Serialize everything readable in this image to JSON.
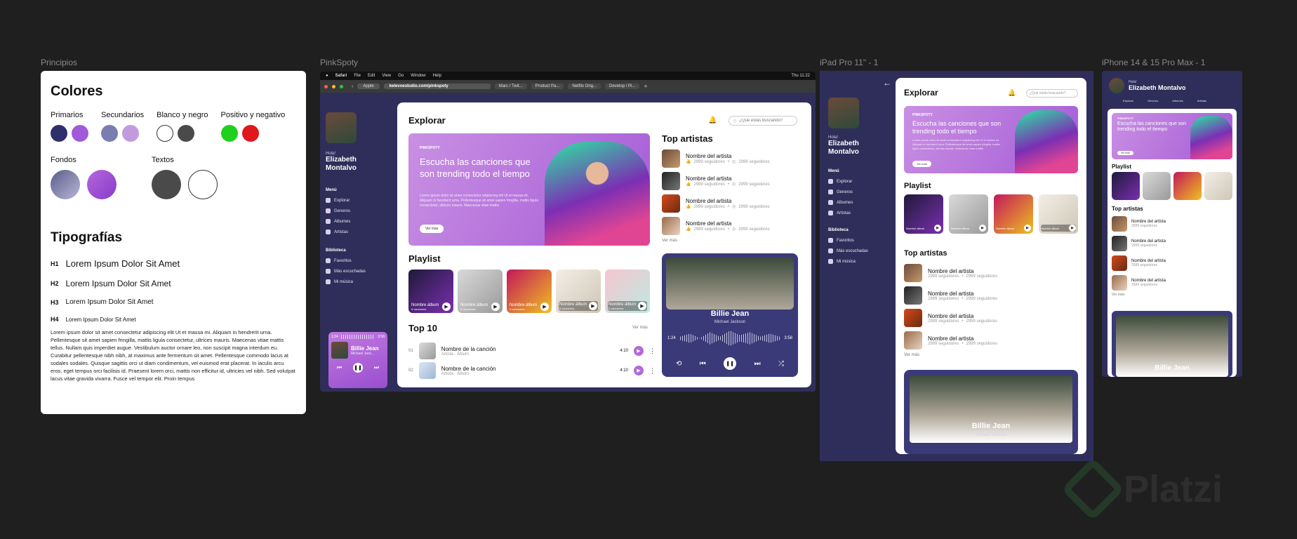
{
  "frames": {
    "principios": "Principios",
    "pinkspoty": "PinkSpoty",
    "ipad": "iPad Pro 11\" - 1",
    "iphone": "iPhone 14 & 15 Pro Max - 1"
  },
  "styleguide": {
    "colors_title": "Colores",
    "groups": [
      {
        "label": "Primarios",
        "swatches": [
          "#2e2f6b",
          "#a259d9"
        ]
      },
      {
        "label": "Secundarios",
        "swatches": [
          "#7a7db0",
          "#c29bdc"
        ]
      },
      {
        "label": "Blanco y negro",
        "swatches": [
          "#ffffff",
          "#4a4a4a"
        ]
      },
      {
        "label": "Positivo y negativo",
        "swatches": [
          "#1fd11f",
          "#e0171b"
        ]
      }
    ],
    "fondos_label": "Fondos",
    "textos_label": "Textos",
    "typo_title": "Tipografías",
    "headings": [
      {
        "tag": "H1",
        "text": "Lorem Ipsum Dolor Sit Amet"
      },
      {
        "tag": "H2",
        "text": "Lorem Ipsum Dolor Sit Amet"
      },
      {
        "tag": "H3",
        "text": "Lorem Ipsum Dolor Sit Amet"
      },
      {
        "tag": "H4",
        "text": "Lorem Ipsum Dolor Sit Amet"
      }
    ],
    "paragraph": "Lorem ipsum dolor sit amet consectetur adipiscing elit Ut et massa mi. Aliquam in hendrerit urna. Pellentesque sit amet sapien fringilla, mattis ligula consectetur, ultrices mauris. Maecenas vitae mattis tellus. Nullam quis imperdiet augue. Vestibulum auctor ornare leo, non suscipit magna interdum eu. Curabitur pellentesque nibh nibh, at maximus ante fermentum sit amet. Pellentesque commodo lacus at sodales sodales. Quisque sagittis orci ut diam condimentum, vel euismod erat placerat. In iaculis arcu eros, eget tempus orci facilisis id. Praesent lorem orci, mattis non efficitur id, ultricies vel nibh. Sed volutpat lacus vitae gravida vivarra. Fusce vel tempor elit. Proin tempus"
  },
  "browser": {
    "menu": [
      "Safari",
      "File",
      "Edit",
      "View",
      "Go",
      "Window",
      "Help"
    ],
    "clock": "Thu 11:22",
    "url": "kelevoestudio.com/pinkspoty",
    "tab_apple": "Apple",
    "tabs": [
      "Marc / Twit...",
      "Product Pa...",
      "Netflix Orig...",
      "Develop / Pi..."
    ]
  },
  "app": {
    "greeting": "Hola!",
    "user_name": "Elizabeth Montalvo",
    "menu_title": "Menú",
    "menu_items": [
      "Explorar",
      "Generos",
      "Albumes",
      "Artistas"
    ],
    "library_title": "Biblioteca",
    "library_items": [
      "Favoritos",
      "Más escuchadas",
      "Mi música"
    ],
    "explore_title": "Explorar",
    "search_placeholder": "¿Qué estás buscando?",
    "hero_tag": "PINKSPOTY",
    "hero_title": "Escucha las canciones que son trending todo el tiempo",
    "hero_body": "Lorem ipsum dolor sit amet consectetur adipiscing elit Ut et massa mi. Aliquam in hendrerit urna. Pellentesque sit amet sapien fringilla, mattis ligula consectetur, ultrices mauris. Maecenas vitae mattis",
    "hero_button": "Ver más",
    "playlist_title": "Playlist",
    "playlists": [
      {
        "name": "Nombre álbum",
        "sub": "5 canciones",
        "style": "dark"
      },
      {
        "name": "Nombre álbum",
        "sub": "5 canciones",
        "style": "gray"
      },
      {
        "name": "Nombre álbum",
        "sub": "5 canciones",
        "style": "pink"
      },
      {
        "name": "Nombre álbum",
        "sub": "5 canciones",
        "style": "tape"
      },
      {
        "name": "Nombre álbum",
        "sub": "5 canciones",
        "style": "mint"
      }
    ],
    "top10_title": "Top 10",
    "see_more": "Ver más",
    "top10": [
      {
        "num": "01",
        "title": "Nombre de la canción",
        "sub": "Artista - Álbum",
        "dur": "4:10"
      },
      {
        "num": "02",
        "title": "Nombre de la canción",
        "sub": "Artista - Álbum",
        "dur": "4:10"
      }
    ],
    "top_artists_title": "Top artistas",
    "artists": [
      {
        "name": "Nombre del artista",
        "likes": "2999 seguidores",
        "followers": "2999 seguidores"
      },
      {
        "name": "Nombre del artista",
        "likes": "2999 seguidores",
        "followers": "2999 seguidores"
      },
      {
        "name": "Nombre del artista",
        "likes": "2999 seguidores",
        "followers": "2999 seguidores"
      },
      {
        "name": "Nombre del artista",
        "likes": "2999 seguidores",
        "followers": "2999 seguidores"
      }
    ],
    "player": {
      "song": "Billie Jean",
      "artist": "Michael Jackson",
      "artist_short": "Michael Jack...",
      "time_start": "1:24",
      "time_end": "3:58"
    }
  },
  "watermark": "Platzi"
}
